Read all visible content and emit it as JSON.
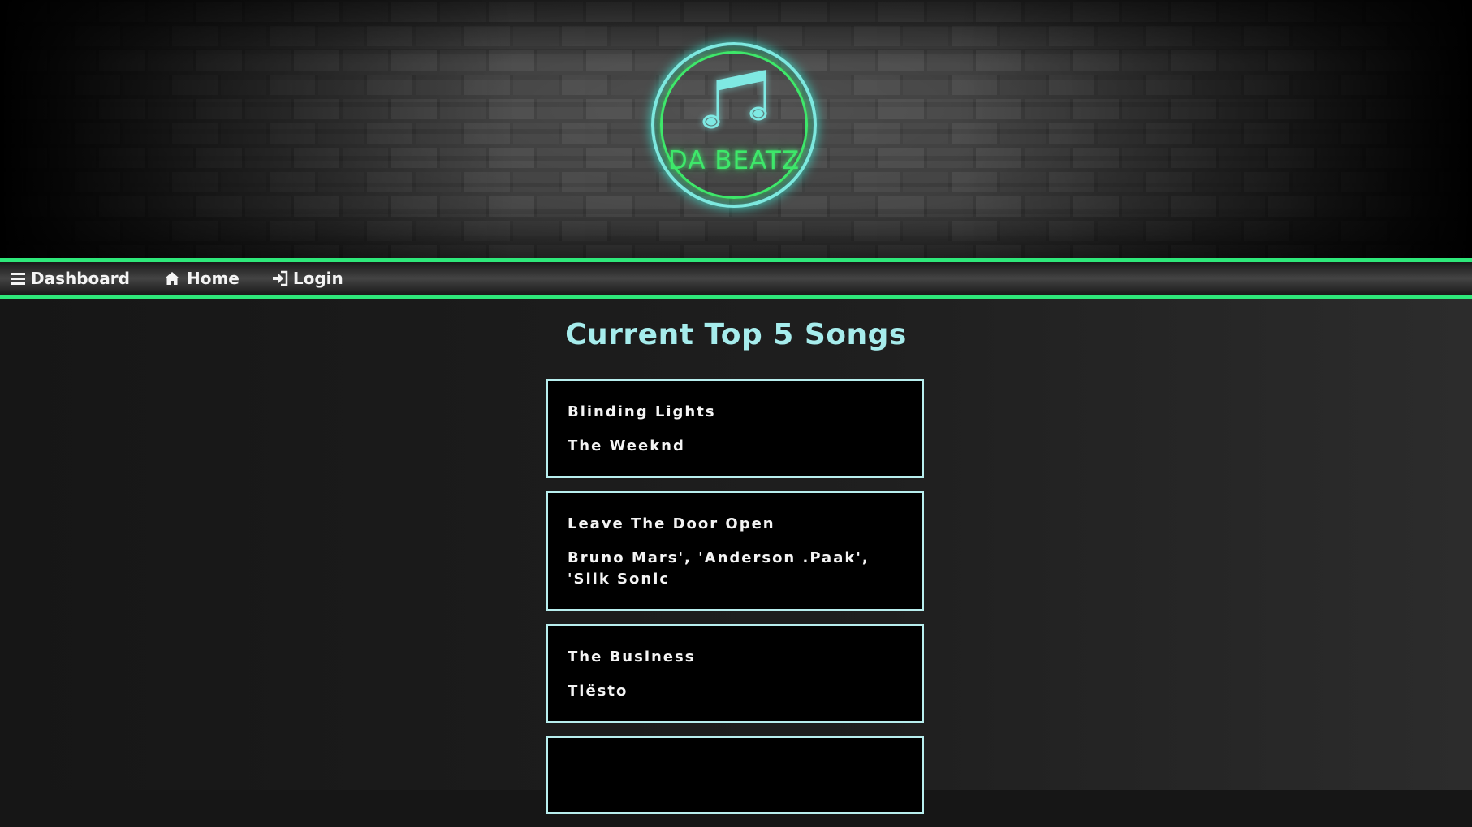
{
  "brand": {
    "logo_text": "DA BEATZ",
    "neon_green": "#3ee86a",
    "neon_cyan": "#7fe9e3"
  },
  "nav": {
    "items": [
      {
        "label": "Dashboard",
        "icon": "bars-icon"
      },
      {
        "label": "Home",
        "icon": "home-icon"
      },
      {
        "label": "Login",
        "icon": "sign-in-icon"
      }
    ]
  },
  "main": {
    "title": "Current Top 5 Songs",
    "songs": [
      {
        "title": "Blinding Lights",
        "artist": "The Weeknd"
      },
      {
        "title": "Leave The Door Open",
        "artist": "Bruno Mars', 'Anderson .Paak', 'Silk Sonic"
      },
      {
        "title": "The Business",
        "artist": "Tiësto"
      },
      {
        "title": "",
        "artist": ""
      }
    ]
  },
  "colors": {
    "accent_green": "#2ee87a",
    "title_cyan": "#a6ecec",
    "card_border": "#b8eeee"
  }
}
